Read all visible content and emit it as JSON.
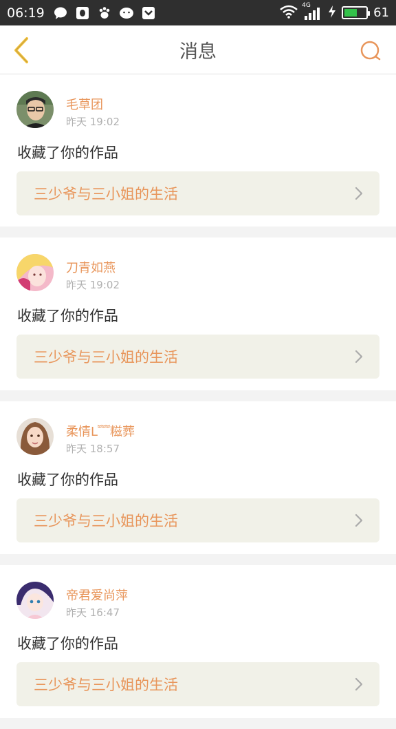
{
  "status_bar": {
    "time": "06:19",
    "network": "4G",
    "battery": "61",
    "battery_fill_fraction": 0.61,
    "icons": [
      "chat-bubble-icon",
      "qq-icon",
      "baidu-paw-icon",
      "wechat-icon",
      "pocket-icon",
      "wifi-icon",
      "signal-icon",
      "charging-icon"
    ]
  },
  "header": {
    "title": "消息",
    "back_icon": "chevron-left-icon",
    "search_icon": "search-icon"
  },
  "colors": {
    "accent": "#e8955a",
    "back_arrow": "#f3c13a",
    "card_link_bg": "#f1f1e8"
  },
  "messages": [
    {
      "username": "毛草团",
      "time": "昨天 19:02",
      "action": "收藏了你的作品",
      "work_title": "三少爷与三小姐的生活"
    },
    {
      "username": "刀青如燕",
      "time": "昨天 19:02",
      "action": "收藏了你的作品",
      "work_title": "三少爷与三小姐的生活"
    },
    {
      "username": "柔情L﹌糍葬",
      "time": "昨天 18:57",
      "action": "收藏了你的作品",
      "work_title": "三少爷与三小姐的生活"
    },
    {
      "username": "帝君爱尚萍",
      "time": "昨天 16:47",
      "action": "收藏了你的作品",
      "work_title": "三少爷与三小姐的生活"
    }
  ]
}
